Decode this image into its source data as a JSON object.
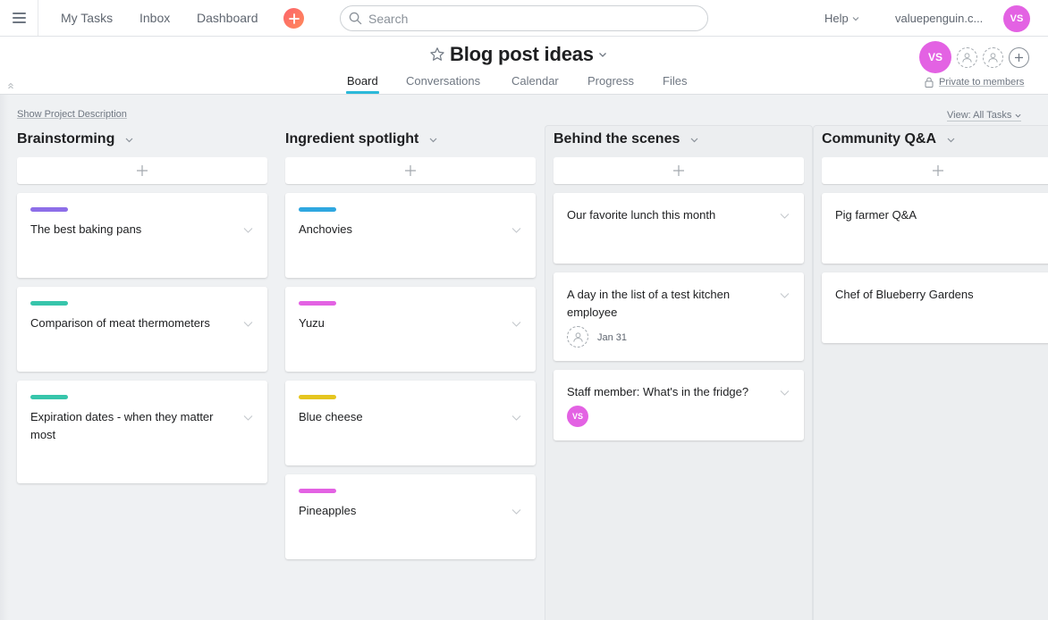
{
  "topbar": {
    "nav": [
      "My Tasks",
      "Inbox",
      "Dashboard"
    ],
    "search_placeholder": "Search",
    "help": "Help",
    "account": "valuepenguin.c...",
    "avatar_initials": "VS"
  },
  "project": {
    "title": "Blog post ideas",
    "tabs": [
      "Board",
      "Conversations",
      "Calendar",
      "Progress",
      "Files"
    ],
    "active_tab": "Board",
    "member_initials": "VS",
    "privacy": "Private to members"
  },
  "board": {
    "show_description": "Show Project Description",
    "view_filter": "View: All Tasks",
    "columns": [
      {
        "title": "Brainstorming",
        "cards": [
          {
            "name": "The best baking pans",
            "tag_color": "#8d6ee8"
          },
          {
            "name": "Comparison of meat thermometers",
            "tag_color": "#37c5ab"
          },
          {
            "name": "Expiration dates - when they matter most",
            "tag_color": "#37c5ab"
          }
        ]
      },
      {
        "title": "Ingredient spotlight",
        "cards": [
          {
            "name": "Anchovies",
            "tag_color": "#2fa7e0"
          },
          {
            "name": "Yuzu",
            "tag_color": "#e362e3"
          },
          {
            "name": "Blue cheese",
            "tag_color": "#e5c51f"
          },
          {
            "name": "Pineapples",
            "tag_color": "#e362e3"
          }
        ]
      },
      {
        "title": "Behind the scenes",
        "cards": [
          {
            "name": "Our favorite lunch this month"
          },
          {
            "name": "A day in the list of a test kitchen employee",
            "due": "Jan 31"
          },
          {
            "name": "Staff member: What's in the fridge?",
            "assignee": "VS"
          }
        ]
      },
      {
        "title": "Community Q&A",
        "cards": [
          {
            "name": "Pig farmer Q&A"
          },
          {
            "name": "Chef of Blueberry Gardens"
          }
        ]
      }
    ]
  },
  "colors": {
    "accent_tab": "#2bb9d9",
    "avatar": "#e362e3",
    "quick_add": "#fc636b"
  }
}
